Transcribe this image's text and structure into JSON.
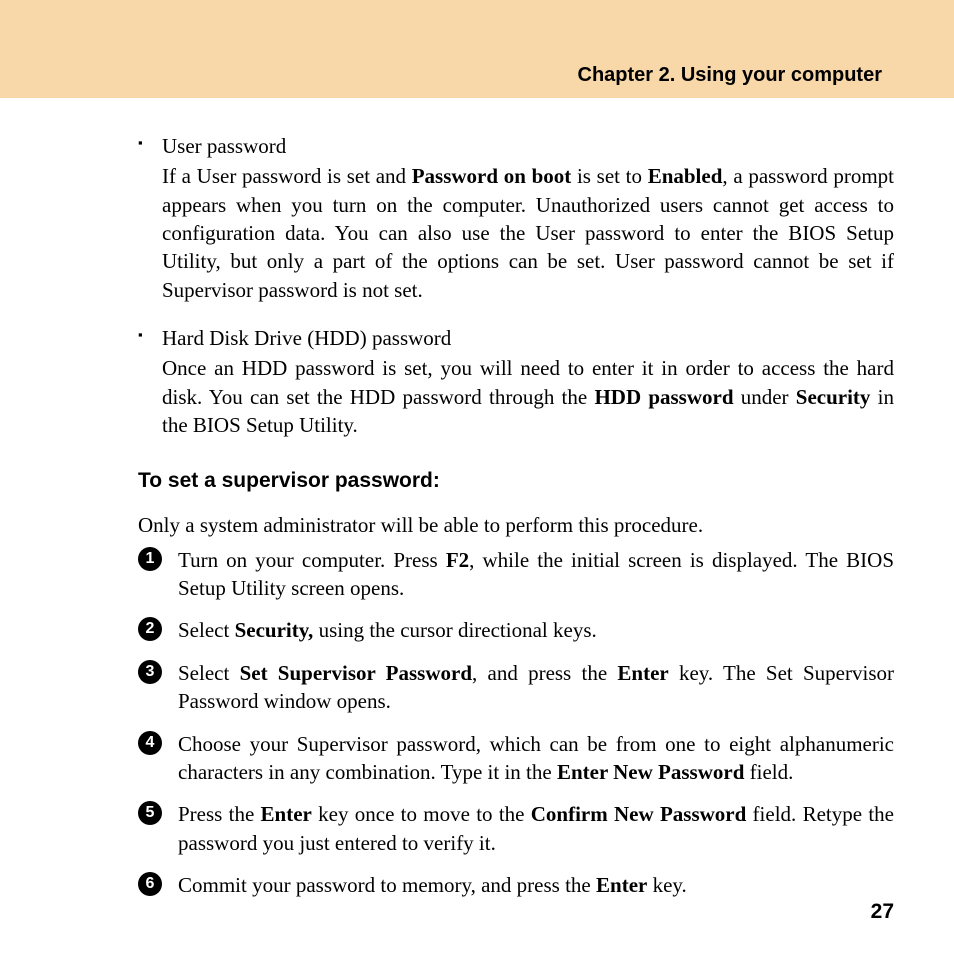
{
  "header": {
    "chapter_title": "Chapter 2. Using your computer"
  },
  "bullets": [
    {
      "term": "User password",
      "desc_html": "If a User password is set and <b>Password on boot</b> is set to <b>Enabled</b>, a password prompt appears when you turn on the computer. Unauthorized users cannot get access to configuration data. You can also use the User password to enter the BIOS Setup Utility, but only a part of the options can be set. User password cannot be set if Supervisor password is not set."
    },
    {
      "term": "Hard Disk Drive (HDD) password",
      "desc_html": "Once an HDD password is set, you will need to enter it in order to access the hard disk. You can set the HDD password through the <b>HDD password</b> under <b>Security</b> in the BIOS Setup Utility."
    }
  ],
  "section_heading": "To set a supervisor password:",
  "section_intro": "Only a system administrator will be able to perform this procedure.",
  "steps_html": [
    "Turn on your computer. Press <b>F2</b>, while the initial screen is displayed. The BIOS Setup Utility screen opens.",
    "Select <b>Security,</b> using the cursor directional keys.",
    "Select <b>Set Supervisor Password</b>, and press the <b>Enter</b> key. The Set Supervisor Password window opens.",
    "Choose your Supervisor password, which can be from one to eight alphanumeric characters in any combination. Type it in the <b>Enter New Password</b> field.",
    "Press the <b>Enter</b> key once to move to the <b>Confirm New Password</b> field. Retype the password you just entered to verify it.",
    "Commit your password to memory, and press the <b>Enter</b> key."
  ],
  "page_number": "27"
}
